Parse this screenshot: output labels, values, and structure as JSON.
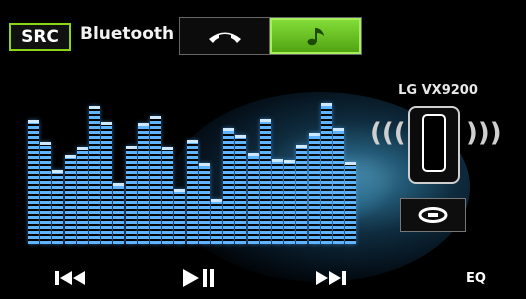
{
  "header": {
    "src_label": "SRC",
    "title": "Bluetooth",
    "tabs": [
      {
        "icon": "phone-handset-icon",
        "active": false
      },
      {
        "icon": "music-note-icon",
        "active": true
      }
    ]
  },
  "device": {
    "name": "LG VX9200",
    "connect_icon": "link-icon"
  },
  "equalizer_levels": [
    0.87,
    0.72,
    0.52,
    0.63,
    0.68,
    0.97,
    0.86,
    0.43,
    0.69,
    0.85,
    0.9,
    0.68,
    0.39,
    0.73,
    0.57,
    0.32,
    0.82,
    0.77,
    0.64,
    0.88,
    0.6,
    0.59,
    0.7,
    0.78,
    0.99,
    0.82,
    0.58
  ],
  "controls": {
    "prev_icon": "skip-previous-icon",
    "play_pause_icon": "play-pause-icon",
    "next_icon": "skip-next-icon",
    "eq_label": "EQ"
  },
  "colors": {
    "accent_green": "#8ad41a",
    "eq_blue": "#5fb4ff"
  }
}
